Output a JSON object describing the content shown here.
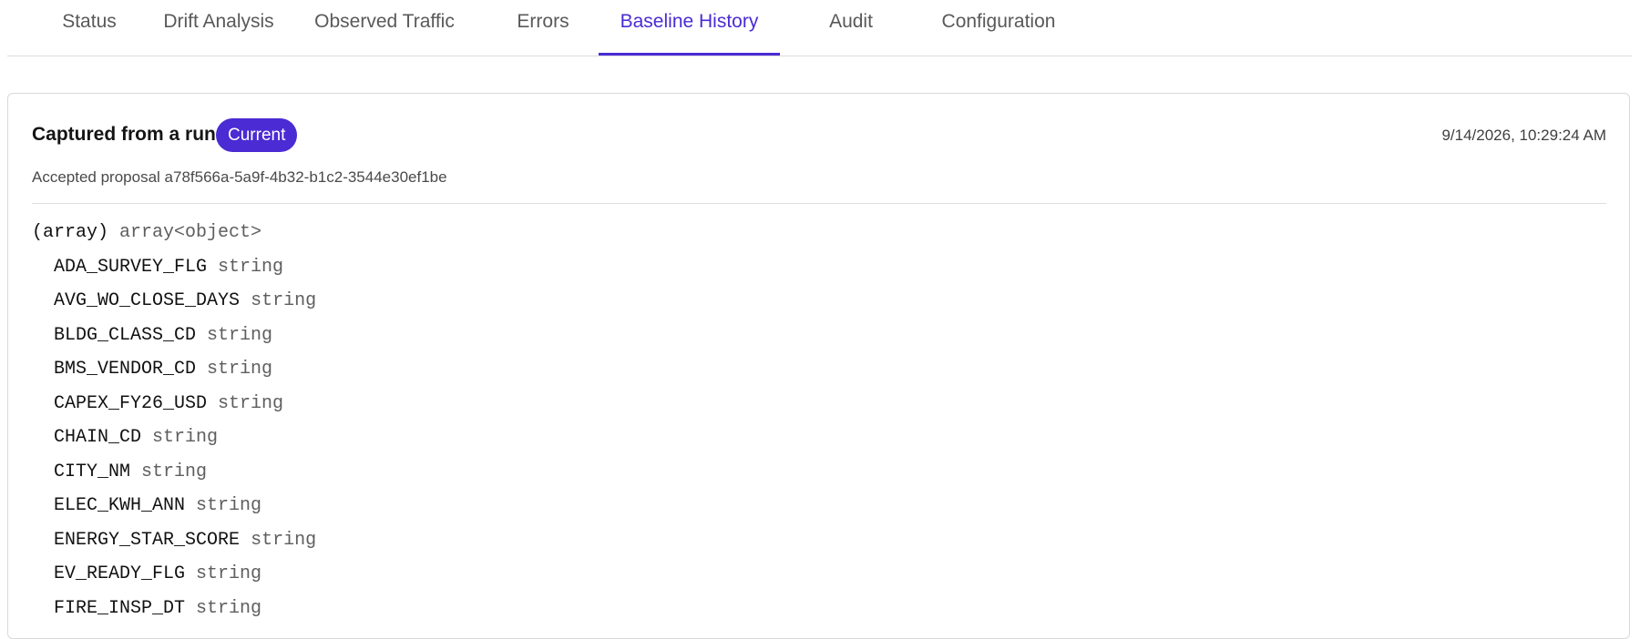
{
  "tabs": [
    {
      "label": "Status",
      "active": false
    },
    {
      "label": "Drift Analysis",
      "active": false
    },
    {
      "label": "Observed Traffic",
      "active": false
    },
    {
      "label": "Errors",
      "active": false
    },
    {
      "label": "Baseline History",
      "active": true
    },
    {
      "label": "Audit",
      "active": false
    },
    {
      "label": "Configuration",
      "active": false
    }
  ],
  "baseline": {
    "title": "Captured from a run",
    "badge": "Current",
    "timestamp": "9/14/2026, 10:29:24 AM",
    "subtitle": "Accepted proposal a78f566a-5a9f-4b32-b1c2-3544e30ef1be"
  },
  "schema": {
    "root": {
      "name": "(array)",
      "type": "array<object>"
    },
    "fields": [
      {
        "name": "ADA_SURVEY_FLG",
        "type": "string"
      },
      {
        "name": "AVG_WO_CLOSE_DAYS",
        "type": "string"
      },
      {
        "name": "BLDG_CLASS_CD",
        "type": "string"
      },
      {
        "name": "BMS_VENDOR_CD",
        "type": "string"
      },
      {
        "name": "CAPEX_FY26_USD",
        "type": "string"
      },
      {
        "name": "CHAIN_CD",
        "type": "string"
      },
      {
        "name": "CITY_NM",
        "type": "string"
      },
      {
        "name": "ELEC_KWH_ANN",
        "type": "string"
      },
      {
        "name": "ENERGY_STAR_SCORE",
        "type": "string"
      },
      {
        "name": "EV_READY_FLG",
        "type": "string"
      },
      {
        "name": "FIRE_INSP_DT",
        "type": "string"
      }
    ]
  },
  "colors": {
    "accent": "#4a2bd4"
  }
}
